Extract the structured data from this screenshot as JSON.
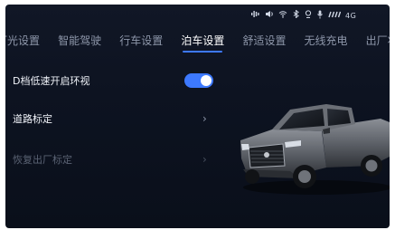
{
  "status": {
    "icons": [
      "voice-icon",
      "speaker-icon",
      "wifi-icon",
      "bluetooth-icon",
      "location-icon",
      "mic-icon",
      "signal-icon"
    ],
    "network": "4G"
  },
  "tabs": [
    {
      "label": "灯光设置",
      "active": false
    },
    {
      "label": "智能驾驶",
      "active": false
    },
    {
      "label": "行车设置",
      "active": false
    },
    {
      "label": "泊车设置",
      "active": true
    },
    {
      "label": "舒适设置",
      "active": false
    },
    {
      "label": "无线充电",
      "active": false
    },
    {
      "label": "出厂状态",
      "active": false
    }
  ],
  "settings": [
    {
      "label": "D档低速开启环视",
      "type": "toggle",
      "enabled": true
    },
    {
      "label": "道路标定",
      "type": "link",
      "enabled": true
    },
    {
      "label": "恢复出厂标定",
      "type": "link",
      "enabled": false
    }
  ],
  "colors": {
    "accent": "#3d79ff",
    "background": "#0d1321"
  }
}
